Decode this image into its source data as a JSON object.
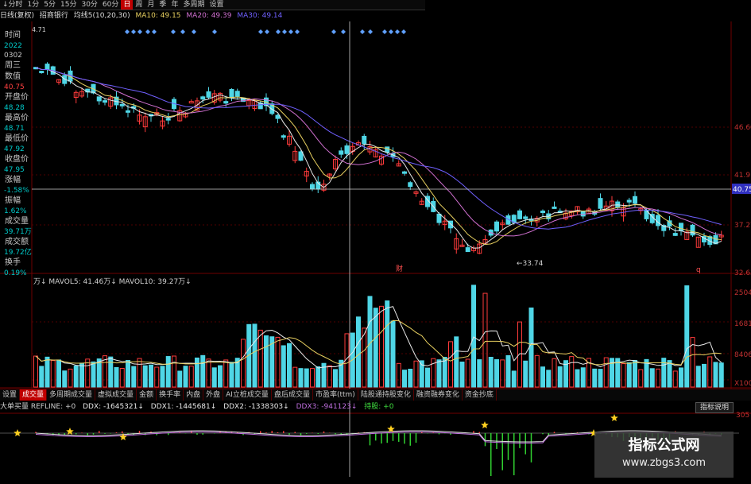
{
  "toolbar": {
    "items": [
      "↓分时",
      "1分",
      "5分",
      "15分",
      "30分",
      "60分",
      "日",
      "周",
      "月",
      "季",
      "年",
      "多周期",
      "设置"
    ],
    "active_index": 6
  },
  "header": {
    "mode": "日线(复权)",
    "stock": "招商银行",
    "ma_label": "均线5(10,20,30)",
    "ma10": "MA10: 49.15",
    "ma20": "MA20: 49.39",
    "ma30": "MA30: 49.14",
    "top_price": "4.71"
  },
  "info_panel": [
    {
      "label": "时间",
      "value": "2022"
    },
    {
      "label": "",
      "value": "0302"
    },
    {
      "label": "周三",
      "value": ""
    },
    {
      "label": "数值",
      "value": "40.75"
    },
    {
      "label": "开盘价",
      "value": "48.28"
    },
    {
      "label": "最高价",
      "value": "48.71"
    },
    {
      "label": "最低价",
      "value": "47.92"
    },
    {
      "label": "收盘价",
      "value": "47.95"
    },
    {
      "label": "涨幅",
      "value": "-1.58%"
    },
    {
      "label": "振幅",
      "value": "1.62%"
    },
    {
      "label": "成交量",
      "value": "39.71万"
    },
    {
      "label": "成交额",
      "value": "19.72亿"
    },
    {
      "label": "换手",
      "value": "0.19%"
    }
  ],
  "price_axis": {
    "ticks": [
      "46.60",
      "41.91",
      "37.27",
      "32.63"
    ],
    "crosshair_value": "40.75",
    "low_label": "33.74",
    "marker_cai": "财",
    "marker_q": "q"
  },
  "volume": {
    "title": "万↓ MAVOL5: 41.46万↓ MAVOL10: 39.27万↓",
    "ticks": [
      "2504",
      "1681",
      "8406",
      "X100"
    ]
  },
  "tabs": {
    "items": [
      "设置",
      "成交量",
      "多周期成交量",
      "虚拟成交量",
      "金额",
      "换手率",
      "内盘",
      "外盘",
      "AI立桩成交量",
      "盘后成交量",
      "市盈率(ttm)",
      "陆股通持股变化",
      "融资融券变化",
      "资金抄底"
    ],
    "active_index": 1
  },
  "ddx": {
    "title": "大单买量 REFLINE: +0",
    "ddx": "DDX: -1645321↓",
    "ddx1": "DDX1: -1445681↓",
    "ddx2": "DDX2: -1338303↓",
    "ddx3": "DDX3: -941123↓",
    "signal": "持股: +0",
    "button": "指标说明",
    "tick": "305"
  },
  "watermark": {
    "title": "指标公式网",
    "url": "www.zbgs3.com"
  },
  "colors": {
    "up": "#ff3b3b",
    "down": "#4fd6e6",
    "ma5": "#e8e8e8",
    "ma10": "#e8d060",
    "ma20": "#d070d0",
    "ma30": "#7060ff",
    "grid": "#700000"
  }
}
